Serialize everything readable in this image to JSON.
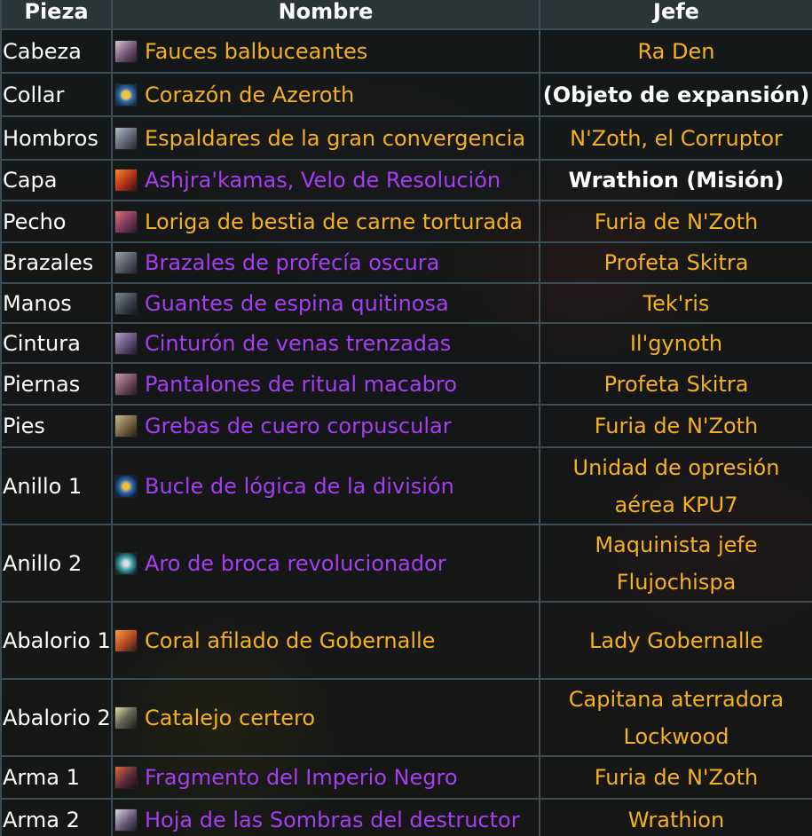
{
  "headers": {
    "pieza": "Pieza",
    "nombre": "Nombre",
    "jefe": "Jefe"
  },
  "colors": {
    "legendary": "#f5b11b",
    "epic": "#a53df2",
    "boss": "#f5b11b"
  },
  "rows": [
    {
      "pieza": "Cabeza",
      "nombre": "Fauces balbuceantes",
      "quality": "orange",
      "icon": "maw-helm-icon",
      "jefe": "Ra Den",
      "jefe_style": "orange"
    },
    {
      "pieza": "Collar",
      "nombre": "Corazón de Azeroth",
      "quality": "orange",
      "icon": "heart-of-azeroth-icon",
      "jefe": "(Objeto de expansión)",
      "jefe_style": "white-b"
    },
    {
      "pieza": "Hombros",
      "nombre": "Espaldares de la gran convergencia",
      "quality": "orange",
      "icon": "shoulder-icon",
      "jefe": "N'Zoth, el Corruptor",
      "jefe_style": "orange"
    },
    {
      "pieza": "Capa",
      "nombre": "Ashjra'kamas, Velo de Resolución",
      "quality": "purple",
      "icon": "cloak-icon",
      "jefe": "Wrathion (Misión)",
      "jefe_style": "white-b"
    },
    {
      "pieza": "Pecho",
      "nombre": "Loriga de bestia de carne torturada",
      "quality": "orange",
      "icon": "chest-icon",
      "jefe": "Furia de N'Zoth",
      "jefe_style": "orange"
    },
    {
      "pieza": "Brazales",
      "nombre": "Brazales de profecía oscura",
      "quality": "purple",
      "icon": "bracers-icon",
      "jefe": "Profeta Skitra",
      "jefe_style": "orange"
    },
    {
      "pieza": "Manos",
      "nombre": "Guantes de espina quitinosa",
      "quality": "purple",
      "icon": "gloves-icon",
      "jefe": "Tek'ris",
      "jefe_style": "orange"
    },
    {
      "pieza": "Cintura",
      "nombre": "Cinturón de venas trenzadas",
      "quality": "purple",
      "icon": "belt-icon",
      "jefe": "Il'gynoth",
      "jefe_style": "orange"
    },
    {
      "pieza": "Piernas",
      "nombre": "Pantalones de ritual macabro",
      "quality": "purple",
      "icon": "legs-icon",
      "jefe": "Profeta Skitra",
      "jefe_style": "orange"
    },
    {
      "pieza": "Pies",
      "nombre": "Grebas de cuero corpuscular",
      "quality": "purple",
      "icon": "boots-icon",
      "jefe": "Furia de N'Zoth",
      "jefe_style": "orange"
    },
    {
      "pieza": "Anillo 1",
      "nombre": "Bucle de lógica de la división",
      "quality": "purple",
      "icon": "ring-icon",
      "jefe": "Unidad de opresión aérea KPU7",
      "jefe_style": "orange"
    },
    {
      "pieza": "Anillo 2",
      "nombre": "Aro de broca revolucionador",
      "quality": "purple",
      "icon": "ring-icon",
      "jefe": "Maquinista jefe Flujochispa",
      "jefe_style": "orange"
    },
    {
      "pieza": "Abalorio 1",
      "nombre": "Coral afilado de Gobernalle",
      "quality": "orange",
      "icon": "coral-trinket-icon",
      "jefe": "Lady Gobernalle",
      "jefe_style": "orange"
    },
    {
      "pieza": "Abalorio 2",
      "nombre": "Catalejo certero",
      "quality": "orange",
      "icon": "spyglass-trinket-icon",
      "jefe": "Capitana aterradora Lockwood",
      "jefe_style": "orange"
    },
    {
      "pieza": "Arma 1",
      "nombre": "Fragmento del Imperio Negro",
      "quality": "purple",
      "icon": "dagger-icon",
      "jefe": "Furia de N'Zoth",
      "jefe_style": "orange"
    },
    {
      "pieza": "Arma 2",
      "nombre": "Hoja de las Sombras del destructor",
      "quality": "purple",
      "icon": "blade-icon",
      "jefe": "Wrathion",
      "jefe_style": "orange"
    }
  ]
}
